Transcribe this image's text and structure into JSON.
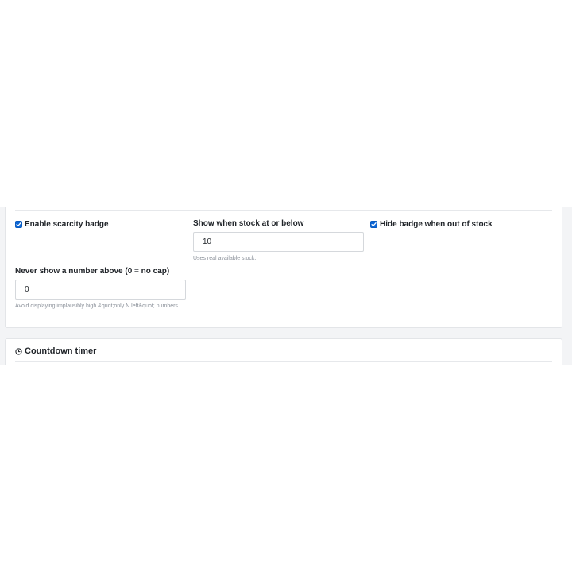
{
  "scarcity": {
    "enable_badge": {
      "label": "Enable scarcity badge",
      "checked": true
    },
    "threshold": {
      "label": "Show when stock at or below",
      "value": "10",
      "help": "Uses real available stock."
    },
    "hide_out_of_stock": {
      "label": "Hide badge when out of stock",
      "checked": true
    },
    "cap": {
      "label": "Never show a number above (0 = no cap)",
      "value": "0",
      "help": "Avoid displaying implausibly high &quot;only N left&quot; numbers."
    }
  },
  "countdown": {
    "title": "Countdown timer",
    "icon": "clock-icon"
  },
  "colors": {
    "accent": "#0b66d6",
    "border": "#e3e5e8",
    "muted": "#8a9099",
    "background": "#f3f4f6"
  }
}
